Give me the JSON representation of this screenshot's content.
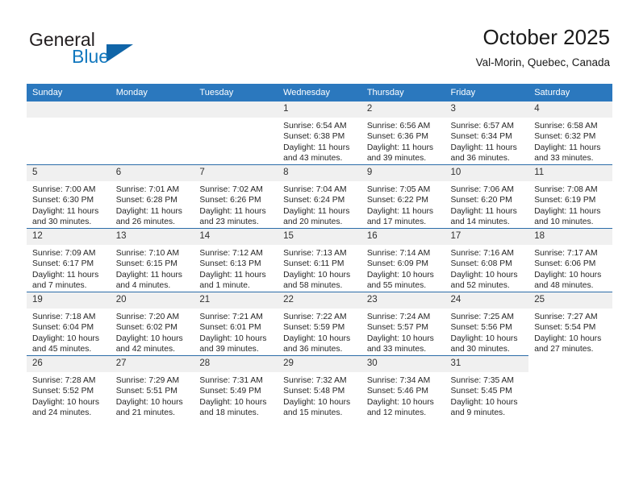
{
  "brand": {
    "name_part1": "General",
    "name_part2": "Blue",
    "accent_color": "#1065a8",
    "text_color": "#231f20"
  },
  "header": {
    "title": "October 2025",
    "subtitle": "Val-Morin, Quebec, Canada"
  },
  "theme": {
    "header_row_bg": "#2b78be",
    "grid_line": "#2b6ca8",
    "daynum_bg": "#f0f0f0"
  },
  "calendar": {
    "weekday_headers": [
      "Sunday",
      "Monday",
      "Tuesday",
      "Wednesday",
      "Thursday",
      "Friday",
      "Saturday"
    ],
    "weeks": [
      [
        {
          "day": "",
          "blank": true,
          "sunrise": "",
          "sunset": "",
          "daylight1": "",
          "daylight2": ""
        },
        {
          "day": "",
          "blank": true,
          "sunrise": "",
          "sunset": "",
          "daylight1": "",
          "daylight2": ""
        },
        {
          "day": "",
          "blank": true,
          "sunrise": "",
          "sunset": "",
          "daylight1": "",
          "daylight2": ""
        },
        {
          "day": "1",
          "sunrise": "Sunrise: 6:54 AM",
          "sunset": "Sunset: 6:38 PM",
          "daylight1": "Daylight: 11 hours",
          "daylight2": "and 43 minutes."
        },
        {
          "day": "2",
          "sunrise": "Sunrise: 6:56 AM",
          "sunset": "Sunset: 6:36 PM",
          "daylight1": "Daylight: 11 hours",
          "daylight2": "and 39 minutes."
        },
        {
          "day": "3",
          "sunrise": "Sunrise: 6:57 AM",
          "sunset": "Sunset: 6:34 PM",
          "daylight1": "Daylight: 11 hours",
          "daylight2": "and 36 minutes."
        },
        {
          "day": "4",
          "sunrise": "Sunrise: 6:58 AM",
          "sunset": "Sunset: 6:32 PM",
          "daylight1": "Daylight: 11 hours",
          "daylight2": "and 33 minutes."
        }
      ],
      [
        {
          "day": "5",
          "sunrise": "Sunrise: 7:00 AM",
          "sunset": "Sunset: 6:30 PM",
          "daylight1": "Daylight: 11 hours",
          "daylight2": "and 30 minutes."
        },
        {
          "day": "6",
          "sunrise": "Sunrise: 7:01 AM",
          "sunset": "Sunset: 6:28 PM",
          "daylight1": "Daylight: 11 hours",
          "daylight2": "and 26 minutes."
        },
        {
          "day": "7",
          "sunrise": "Sunrise: 7:02 AM",
          "sunset": "Sunset: 6:26 PM",
          "daylight1": "Daylight: 11 hours",
          "daylight2": "and 23 minutes."
        },
        {
          "day": "8",
          "sunrise": "Sunrise: 7:04 AM",
          "sunset": "Sunset: 6:24 PM",
          "daylight1": "Daylight: 11 hours",
          "daylight2": "and 20 minutes."
        },
        {
          "day": "9",
          "sunrise": "Sunrise: 7:05 AM",
          "sunset": "Sunset: 6:22 PM",
          "daylight1": "Daylight: 11 hours",
          "daylight2": "and 17 minutes."
        },
        {
          "day": "10",
          "sunrise": "Sunrise: 7:06 AM",
          "sunset": "Sunset: 6:20 PM",
          "daylight1": "Daylight: 11 hours",
          "daylight2": "and 14 minutes."
        },
        {
          "day": "11",
          "sunrise": "Sunrise: 7:08 AM",
          "sunset": "Sunset: 6:19 PM",
          "daylight1": "Daylight: 11 hours",
          "daylight2": "and 10 minutes."
        }
      ],
      [
        {
          "day": "12",
          "sunrise": "Sunrise: 7:09 AM",
          "sunset": "Sunset: 6:17 PM",
          "daylight1": "Daylight: 11 hours",
          "daylight2": "and 7 minutes."
        },
        {
          "day": "13",
          "sunrise": "Sunrise: 7:10 AM",
          "sunset": "Sunset: 6:15 PM",
          "daylight1": "Daylight: 11 hours",
          "daylight2": "and 4 minutes."
        },
        {
          "day": "14",
          "sunrise": "Sunrise: 7:12 AM",
          "sunset": "Sunset: 6:13 PM",
          "daylight1": "Daylight: 11 hours",
          "daylight2": "and 1 minute."
        },
        {
          "day": "15",
          "sunrise": "Sunrise: 7:13 AM",
          "sunset": "Sunset: 6:11 PM",
          "daylight1": "Daylight: 10 hours",
          "daylight2": "and 58 minutes."
        },
        {
          "day": "16",
          "sunrise": "Sunrise: 7:14 AM",
          "sunset": "Sunset: 6:09 PM",
          "daylight1": "Daylight: 10 hours",
          "daylight2": "and 55 minutes."
        },
        {
          "day": "17",
          "sunrise": "Sunrise: 7:16 AM",
          "sunset": "Sunset: 6:08 PM",
          "daylight1": "Daylight: 10 hours",
          "daylight2": "and 52 minutes."
        },
        {
          "day": "18",
          "sunrise": "Sunrise: 7:17 AM",
          "sunset": "Sunset: 6:06 PM",
          "daylight1": "Daylight: 10 hours",
          "daylight2": "and 48 minutes."
        }
      ],
      [
        {
          "day": "19",
          "sunrise": "Sunrise: 7:18 AM",
          "sunset": "Sunset: 6:04 PM",
          "daylight1": "Daylight: 10 hours",
          "daylight2": "and 45 minutes."
        },
        {
          "day": "20",
          "sunrise": "Sunrise: 7:20 AM",
          "sunset": "Sunset: 6:02 PM",
          "daylight1": "Daylight: 10 hours",
          "daylight2": "and 42 minutes."
        },
        {
          "day": "21",
          "sunrise": "Sunrise: 7:21 AM",
          "sunset": "Sunset: 6:01 PM",
          "daylight1": "Daylight: 10 hours",
          "daylight2": "and 39 minutes."
        },
        {
          "day": "22",
          "sunrise": "Sunrise: 7:22 AM",
          "sunset": "Sunset: 5:59 PM",
          "daylight1": "Daylight: 10 hours",
          "daylight2": "and 36 minutes."
        },
        {
          "day": "23",
          "sunrise": "Sunrise: 7:24 AM",
          "sunset": "Sunset: 5:57 PM",
          "daylight1": "Daylight: 10 hours",
          "daylight2": "and 33 minutes."
        },
        {
          "day": "24",
          "sunrise": "Sunrise: 7:25 AM",
          "sunset": "Sunset: 5:56 PM",
          "daylight1": "Daylight: 10 hours",
          "daylight2": "and 30 minutes."
        },
        {
          "day": "25",
          "sunrise": "Sunrise: 7:27 AM",
          "sunset": "Sunset: 5:54 PM",
          "daylight1": "Daylight: 10 hours",
          "daylight2": "and 27 minutes."
        }
      ],
      [
        {
          "day": "26",
          "sunrise": "Sunrise: 7:28 AM",
          "sunset": "Sunset: 5:52 PM",
          "daylight1": "Daylight: 10 hours",
          "daylight2": "and 24 minutes."
        },
        {
          "day": "27",
          "sunrise": "Sunrise: 7:29 AM",
          "sunset": "Sunset: 5:51 PM",
          "daylight1": "Daylight: 10 hours",
          "daylight2": "and 21 minutes."
        },
        {
          "day": "28",
          "sunrise": "Sunrise: 7:31 AM",
          "sunset": "Sunset: 5:49 PM",
          "daylight1": "Daylight: 10 hours",
          "daylight2": "and 18 minutes."
        },
        {
          "day": "29",
          "sunrise": "Sunrise: 7:32 AM",
          "sunset": "Sunset: 5:48 PM",
          "daylight1": "Daylight: 10 hours",
          "daylight2": "and 15 minutes."
        },
        {
          "day": "30",
          "sunrise": "Sunrise: 7:34 AM",
          "sunset": "Sunset: 5:46 PM",
          "daylight1": "Daylight: 10 hours",
          "daylight2": "and 12 minutes."
        },
        {
          "day": "31",
          "sunrise": "Sunrise: 7:35 AM",
          "sunset": "Sunset: 5:45 PM",
          "daylight1": "Daylight: 10 hours",
          "daylight2": "and 9 minutes."
        },
        {
          "day": "",
          "nogrid": true,
          "sunrise": "",
          "sunset": "",
          "daylight1": "",
          "daylight2": ""
        }
      ]
    ]
  }
}
